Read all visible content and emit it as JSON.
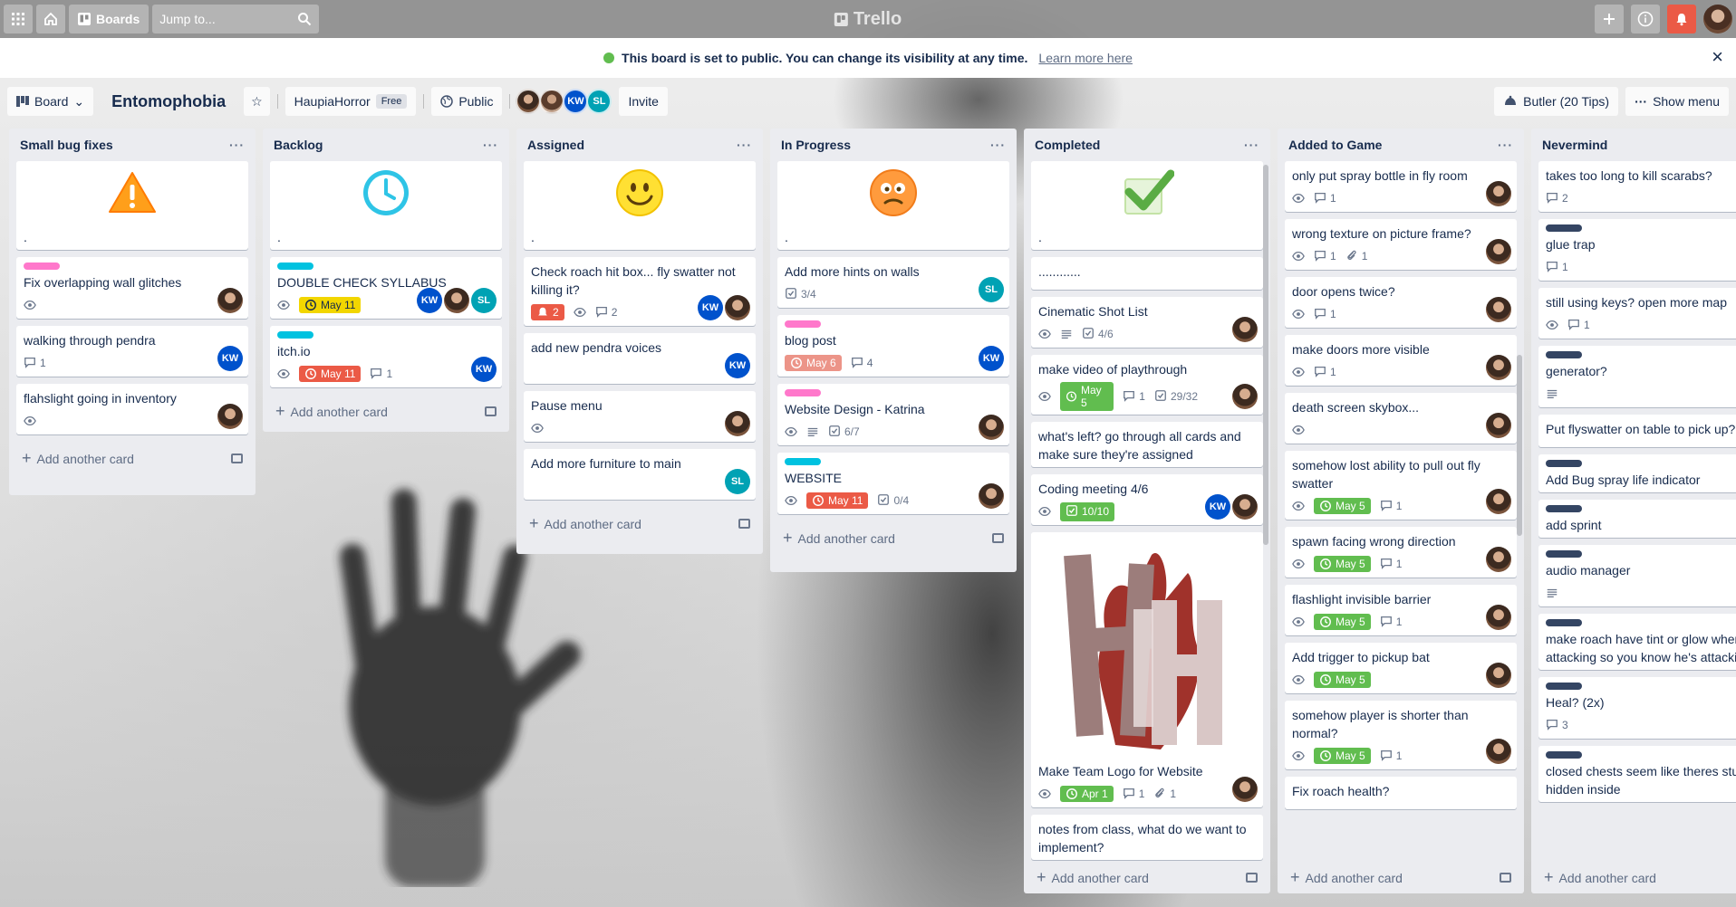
{
  "topbar": {
    "boards_label": "Boards",
    "jump_placeholder": "Jump to...",
    "logo_text": "Trello"
  },
  "banner": {
    "message": "This board is set to public. You can change its visibility at any time.",
    "link": "Learn more here"
  },
  "header": {
    "view_label": "Board",
    "board_title": "Entomophobia",
    "team_name": "HaupiaHorror",
    "team_plan": "Free",
    "visibility": "Public",
    "invite": "Invite",
    "butler": "Butler (20 Tips)",
    "show_menu": "Show menu",
    "members": [
      "KW",
      "SL"
    ]
  },
  "add_card_label": "Add another card",
  "lists": [
    {
      "title": "Small bug fixes",
      "cards": [
        {
          "title": ".",
          "cover": "warning"
        },
        {
          "title": "Fix overlapping wall glitches",
          "label": "#ff78cb",
          "watch": true,
          "members": [
            "photo"
          ]
        },
        {
          "title": "walking through pendra",
          "comments": "1",
          "members": [
            "KW"
          ]
        },
        {
          "title": "flahslight going in inventory",
          "watch": true,
          "members": [
            "photo"
          ]
        }
      ]
    },
    {
      "title": "Backlog",
      "cards": [
        {
          "title": ".",
          "cover": "clock"
        },
        {
          "title": "DOUBLE CHECK SYLLABUS",
          "label": "#00c2e0",
          "watch": true,
          "due": "May 11",
          "due_color": "yellow",
          "members": [
            "KW",
            "photo",
            "SL"
          ]
        },
        {
          "title": "itch.io",
          "label": "#00c2e0",
          "watch": true,
          "due": "May 11",
          "due_color": "red",
          "comments": "1",
          "members": [
            "KW"
          ]
        }
      ]
    },
    {
      "title": "Assigned",
      "cards": [
        {
          "title": ".",
          "cover": "smile"
        },
        {
          "title": "Check roach hit box... fly swatter not killing it?",
          "alert": "2",
          "watch": true,
          "comments": "2",
          "members": [
            "KW",
            "photo"
          ]
        },
        {
          "title": "add new pendra voices",
          "members": [
            "KW"
          ]
        },
        {
          "title": "Pause menu",
          "watch": true,
          "members": [
            "photo"
          ]
        },
        {
          "title": "Add more furniture to main",
          "members": [
            "SL"
          ]
        }
      ]
    },
    {
      "title": "In Progress",
      "cards": [
        {
          "title": ".",
          "cover": "worried"
        },
        {
          "title": "Add more hints on walls",
          "checklist": "3/4",
          "members": [
            "SL"
          ]
        },
        {
          "title": "blog post",
          "label": "#ff78cb",
          "due": "May 6",
          "due_color": "lightred",
          "comments": "4",
          "members": [
            "KW"
          ]
        },
        {
          "title": "Website Design - Katrina",
          "label": "#ff78cb",
          "watch": true,
          "desc": true,
          "checklist": "6/7",
          "members": [
            "photo"
          ]
        },
        {
          "title": "WEBSITE",
          "label": "#00c2e0",
          "watch": true,
          "due": "May 11",
          "due_color": "red",
          "checklist": "0/4",
          "members": [
            "photo"
          ]
        }
      ]
    },
    {
      "title": "Completed",
      "cards": [
        {
          "title": ".",
          "cover": "check"
        },
        {
          "title": "............"
        },
        {
          "title": "Cinematic Shot List",
          "watch": true,
          "desc": true,
          "checklist": "4/6",
          "members": [
            "photo"
          ]
        },
        {
          "title": "make video of playthrough",
          "watch": true,
          "due": "May 5",
          "due_color": "green",
          "comments": "1",
          "checklist": "29/32",
          "members": [
            "photo"
          ]
        },
        {
          "title": "what's left? go through all cards and make sure they're assigned"
        },
        {
          "title": "Coding meeting 4/6",
          "watch": true,
          "checklist": "10/10",
          "checklist_done": true,
          "members": [
            "KW",
            "photo"
          ]
        },
        {
          "title": "Make Team Logo for Website",
          "cover": "logo",
          "watch": true,
          "due": "Apr 1",
          "due_color": "green",
          "comments": "1",
          "attachments": "1",
          "members": [
            "photo"
          ]
        },
        {
          "title": "notes from class, what do we want to implement?"
        }
      ]
    },
    {
      "title": "Added to Game",
      "cards": [
        {
          "title": "only put spray bottle in fly room",
          "watch": true,
          "comments": "1",
          "members": [
            "photo"
          ]
        },
        {
          "title": "wrong texture on picture frame?",
          "watch": true,
          "comments": "1",
          "attachments": "1",
          "members": [
            "photo"
          ]
        },
        {
          "title": "door opens twice?",
          "watch": true,
          "comments": "1",
          "members": [
            "photo"
          ]
        },
        {
          "title": "make doors more visible",
          "watch": true,
          "comments": "1",
          "members": [
            "photo"
          ]
        },
        {
          "title": "death screen skybox...",
          "watch": true,
          "members": [
            "photo"
          ]
        },
        {
          "title": "somehow lost ability to pull out fly swatter",
          "watch": true,
          "due": "May 5",
          "due_color": "green",
          "comments": "1",
          "members": [
            "photo"
          ]
        },
        {
          "title": "spawn facing wrong direction",
          "watch": true,
          "due": "May 5",
          "due_color": "green",
          "comments": "1",
          "members": [
            "photo"
          ]
        },
        {
          "title": "flashlight invisible barrier",
          "watch": true,
          "due": "May 5",
          "due_color": "green",
          "comments": "1",
          "members": [
            "photo"
          ]
        },
        {
          "title": "Add trigger to pickup bat",
          "watch": true,
          "due": "May 5",
          "due_color": "green",
          "members": [
            "photo"
          ]
        },
        {
          "title": "somehow player is shorter than normal?",
          "watch": true,
          "due": "May 5",
          "due_color": "green",
          "comments": "1",
          "members": [
            "photo"
          ]
        },
        {
          "title": "Fix roach health?"
        }
      ]
    },
    {
      "title": "Nevermind",
      "cards": [
        {
          "title": "takes too long to kill scarabs?",
          "comments": "2"
        },
        {
          "title": "glue trap",
          "label": "#344563",
          "comments": "1"
        },
        {
          "title": "still using keys? open more map",
          "watch": true,
          "comments": "1"
        },
        {
          "title": "generator?",
          "label": "#344563",
          "desc": true
        },
        {
          "title": "Put flyswatter on table to pick up?"
        },
        {
          "title": "Add Bug spray life indicator",
          "label": "#344563"
        },
        {
          "title": "add sprint",
          "label": "#344563"
        },
        {
          "title": "audio manager",
          "label": "#344563",
          "desc": true
        },
        {
          "title": "make roach have tint or glow when attacking so you know he's attacking?",
          "label": "#344563"
        },
        {
          "title": "Heal? (2x)",
          "label": "#344563",
          "comments": "3"
        },
        {
          "title": "closed chests seem like theres stuff hidden inside",
          "label": "#344563"
        }
      ]
    }
  ]
}
